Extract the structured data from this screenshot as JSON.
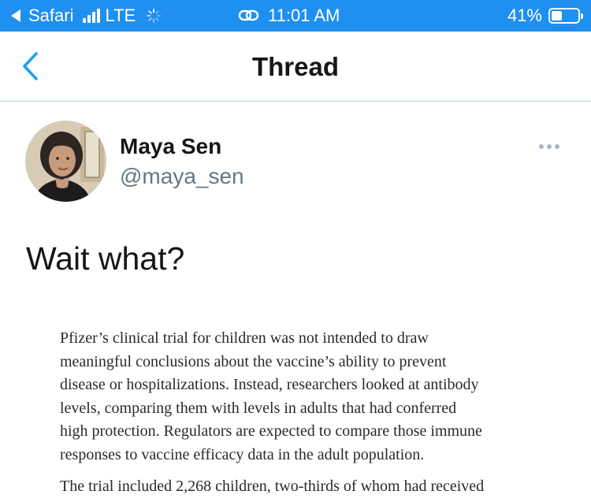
{
  "status_bar": {
    "carrier_app": "Safari",
    "network": "LTE",
    "time": "11:01 AM",
    "battery_percent": "41%",
    "battery_level": 0.41,
    "background_color": "#1f8ff0"
  },
  "header": {
    "title": "Thread",
    "back_icon": "chevron-left-icon",
    "accent_color": "#1da1f2"
  },
  "tweet": {
    "display_name": "Maya Sen",
    "handle": "@maya_sen",
    "text": "Wait what?",
    "more_icon": "more-horizontal-icon"
  },
  "article_excerpt": {
    "paragraph_1_lines": [
      "Pfizer’s clinical trial for children was not intended to draw",
      "meaningful conclusions about the vaccine’s ability to prevent",
      "disease or hospitalizations. Instead, researchers looked at antibody",
      "levels, comparing them with levels in adults that had conferred",
      "high protection. Regulators are expected to compare those immune",
      "responses to vaccine efficacy data in the adult population."
    ],
    "paragraph_2_partial": "The trial included 2,268 children, two-thirds of whom had received"
  }
}
